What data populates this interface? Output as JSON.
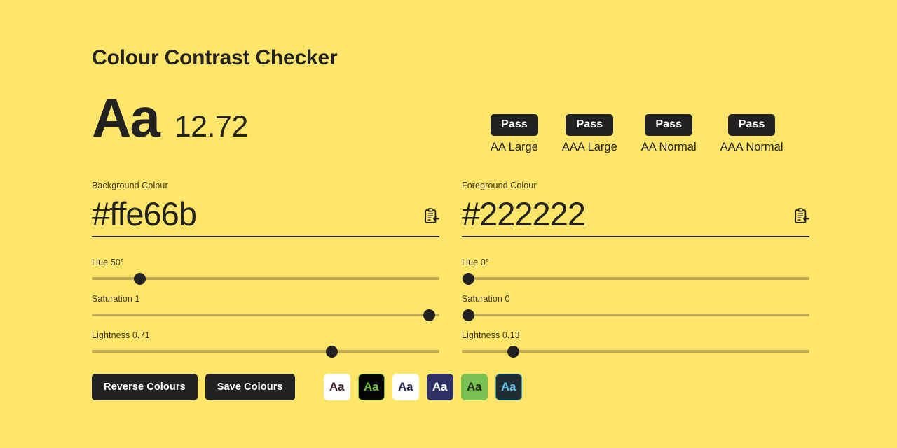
{
  "page": {
    "title": "Colour Contrast Checker",
    "background_colour": "#ffe66b",
    "text_colour": "#222222"
  },
  "preview": {
    "sample_text": "Aa",
    "contrast_ratio": "12.72"
  },
  "compliance": {
    "items": [
      {
        "result": "Pass",
        "label": "AA Large"
      },
      {
        "result": "Pass",
        "label": "AAA Large"
      },
      {
        "result": "Pass",
        "label": "AA Normal"
      },
      {
        "result": "Pass",
        "label": "AAA Normal"
      }
    ]
  },
  "background_colour_panel": {
    "label": "Background Colour",
    "hex_value": "#ffe66b",
    "hex_placeholder": "#ffe66b",
    "paste_icon": "clipboard-paste-icon",
    "sliders": [
      {
        "name": "hue",
        "label": "Hue 50°",
        "value": 50,
        "min": 0,
        "max": 360,
        "percent": 13.9
      },
      {
        "name": "saturation",
        "label": "Saturation 1",
        "value": 1,
        "min": 0,
        "max": 1,
        "percent": 97
      },
      {
        "name": "lightness",
        "label": "Lightness 0.71",
        "value": 0.71,
        "min": 0,
        "max": 1,
        "percent": 69
      }
    ]
  },
  "foreground_colour_panel": {
    "label": "Foreground Colour",
    "hex_value": "#222222",
    "hex_placeholder": "#222222",
    "paste_icon": "clipboard-paste-icon",
    "sliders": [
      {
        "name": "hue",
        "label": "Hue 0°",
        "value": 0,
        "min": 0,
        "max": 360,
        "percent": 2
      },
      {
        "name": "saturation",
        "label": "Saturation 0",
        "value": 0,
        "min": 0,
        "max": 1,
        "percent": 2
      },
      {
        "name": "lightness",
        "label": "Lightness 0.13",
        "value": 0.13,
        "min": 0,
        "max": 1,
        "percent": 14.8
      }
    ]
  },
  "actions": {
    "reverse_label": "Reverse Colours",
    "save_label": "Save Colours"
  },
  "saved_swatches": [
    {
      "sample": "Aa",
      "background": "#ffffff",
      "foreground": "#3b1f23",
      "border": "#ffffff"
    },
    {
      "sample": "Aa",
      "background": "#050505",
      "foreground": "#76c043",
      "border": "#76c043"
    },
    {
      "sample": "Aa",
      "background": "#ffffff",
      "foreground": "#1f2550",
      "border": "#ffffff"
    },
    {
      "sample": "Aa",
      "background": "#2f3166",
      "foreground": "#ffffff",
      "border": "#2f3166"
    },
    {
      "sample": "Aa",
      "background": "#7ac153",
      "foreground": "#1d2a14",
      "border": "#7ac153"
    },
    {
      "sample": "Aa",
      "background": "#1f2c33",
      "foreground": "#63c6e8",
      "border": "#2a9fc4"
    }
  ]
}
